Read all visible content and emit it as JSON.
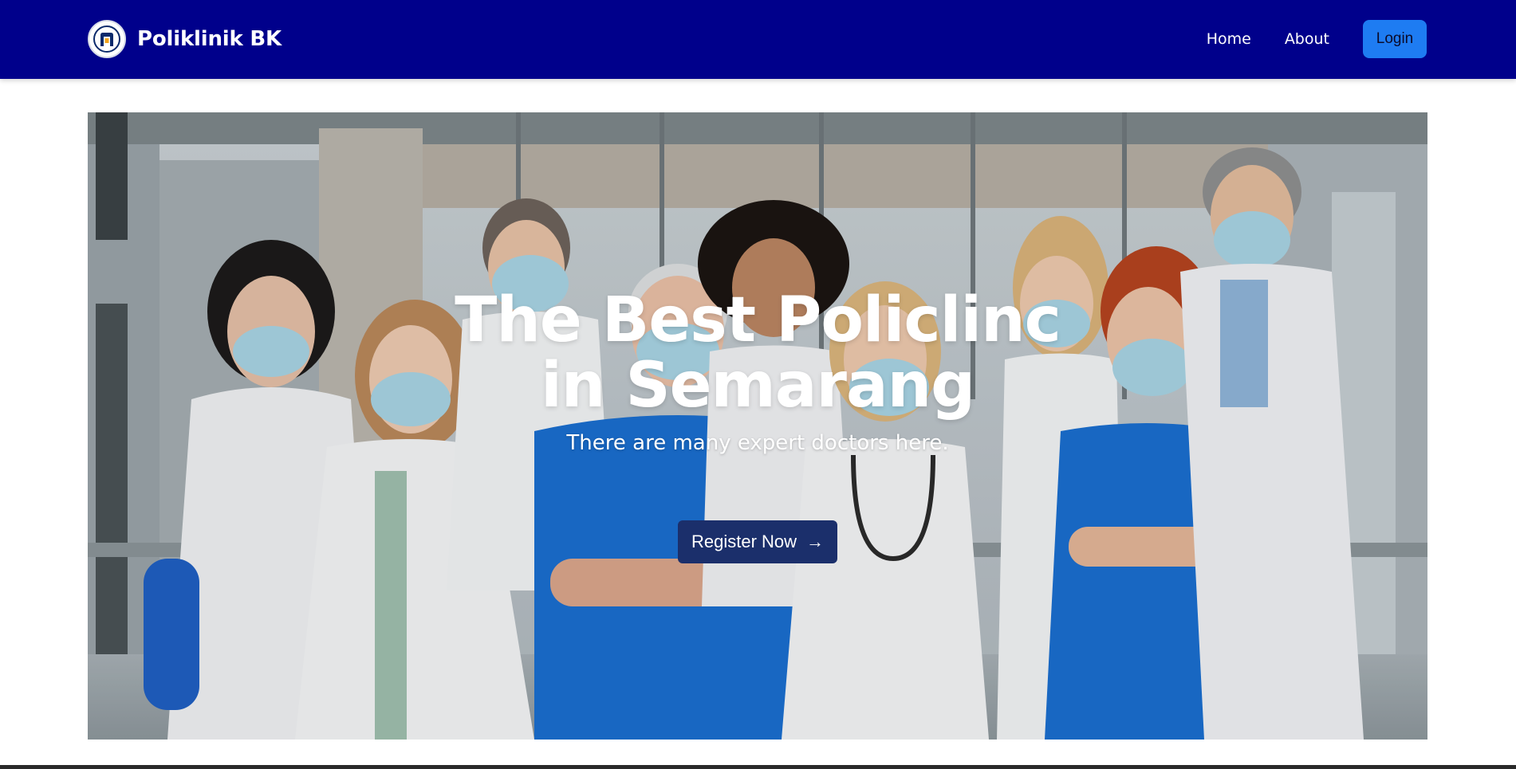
{
  "navbar": {
    "brand_name": "Poliklinik BK",
    "links": [
      {
        "label": "Home"
      },
      {
        "label": "About"
      }
    ],
    "login_label": "Login"
  },
  "hero": {
    "title": "The Best Policlinc in Semarang",
    "subtitle": "There are many expert doctors here.",
    "cta_label": "Register Now",
    "cta_icon": "→"
  },
  "colors": {
    "navbar": "#00008b",
    "login_button": "#1e7cf2",
    "cta_button": "#1b2f6b"
  }
}
